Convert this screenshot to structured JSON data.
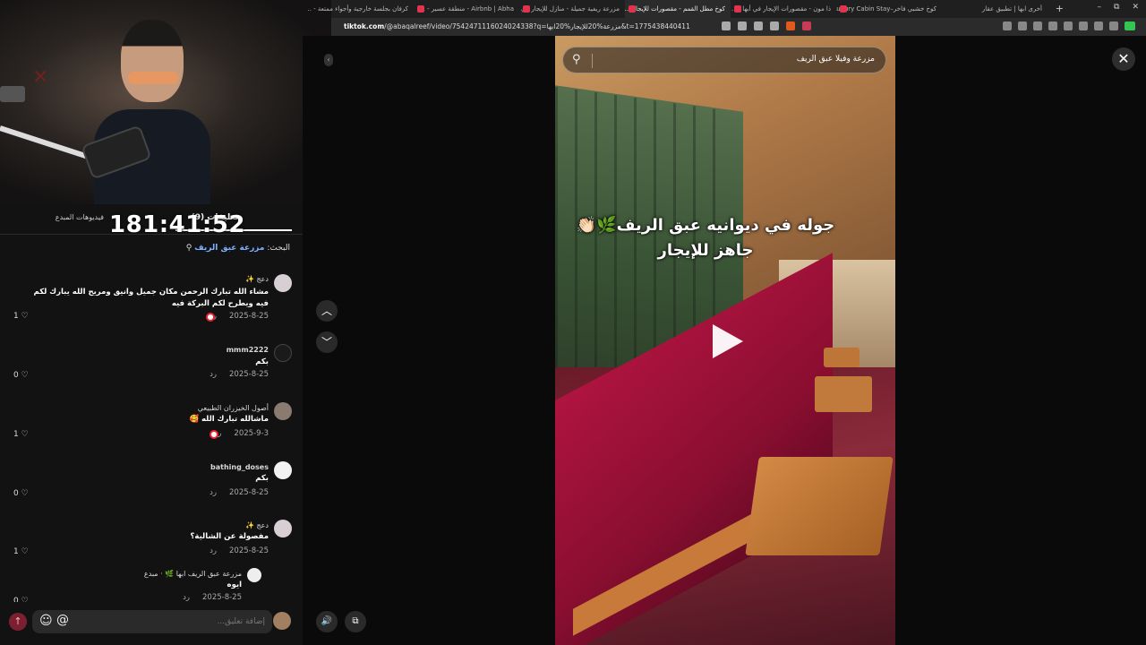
{
  "browser": {
    "tabs": [
      {
        "title": "أخرى ابها | تطبيق عقار",
        "active": false
      },
      {
        "title": "كوخ خشبي فاخر–Luxury Cabin Stay",
        "active": false
      },
      {
        "title": "ذا مون - مقصورات الإيجار في أبها و...",
        "active": false
      },
      {
        "title": "كوخ مطل القمم - مقصورات للإيجار ...",
        "active": true
      },
      {
        "title": "مزرعة ريفية جميلة - منازل للإيجار في ...",
        "active": false
      },
      {
        "title": "Airbnb | Abha - منطقة عسير - ...",
        "active": false
      },
      {
        "title": "كرفان بجلسة خارجية وأجواء ممتعة - ...",
        "active": false
      }
    ],
    "new_tab_label": "+",
    "window_controls": [
      "–",
      "⧉",
      "✕"
    ],
    "url_host": "tiktok.com",
    "url_path": "/@abaqalreef/video/7542471116024024338?q=مزرعة%20للإيجار%20ابها&t=1775438440411"
  },
  "stream": {
    "timer": "181:41:52"
  },
  "comments_panel": {
    "tab_comments": "(9) تعليقات",
    "tab_creator_videos": "فيديوهات المبدع",
    "search_prefix": "البحث:",
    "search_query": "مزرعة عبق الريف",
    "search_icon": "search-icon",
    "comments": [
      {
        "user": "دعج ✨",
        "text": "مشاء الله تبارك الرحمن مكان جميل وانيق ومريح الله يبارك لكم فيه ويطرح لكم البركة فيه",
        "date": "2025-8-25",
        "reply": "رد",
        "likes": "1",
        "liked_by_creator": true
      },
      {
        "user": "mmm2222",
        "text": "بكم",
        "date": "2025-8-25",
        "reply": "رد",
        "likes": "0",
        "liked_by_creator": false
      },
      {
        "user": "أصول الخيزران الطبيعي",
        "text": "ماشالله تبارك الله 🥰",
        "date": "2025-9-3",
        "reply": "رد",
        "likes": "1",
        "liked_by_creator": true
      },
      {
        "user": "bathing_doses",
        "text": "بكم",
        "date": "2025-8-25",
        "reply": "رد",
        "likes": "0",
        "liked_by_creator": false
      },
      {
        "user": "دعج ✨",
        "text": "مفصولة عن الشالية؟",
        "date": "2025-8-25",
        "reply": "رد",
        "likes": "1",
        "liked_by_creator": false
      },
      {
        "user": "مزرعة عبق الريف ابها 🌿 · مبدع",
        "text": "ايوه",
        "date": "2025-8-25",
        "reply": "رد",
        "likes": "0",
        "liked_by_creator": false
      }
    ],
    "input_placeholder": "إضافة تعليق...",
    "send_icon": "arrow-up-icon",
    "emoji_icon": "emoji-icon",
    "mention_label": "@"
  },
  "viewer": {
    "search_placeholder": "مزرعة وفيلا عبق الريف",
    "overlay_line1": "جوله في ديوانيه عبق الريف🌿👏🏻",
    "overlay_line2": "جاهز للإيجار",
    "close_label": "✕",
    "nav_up_label": "︿",
    "nav_down_label": "﹀",
    "volume_icon": "speaker-icon",
    "pip_icon": "picture-in-picture-icon"
  },
  "colors": {
    "accent_link": "#7fb0ff",
    "send_button": "#7a2030",
    "tab_favicon": "#e0334e",
    "extension_green": "#33c653"
  }
}
